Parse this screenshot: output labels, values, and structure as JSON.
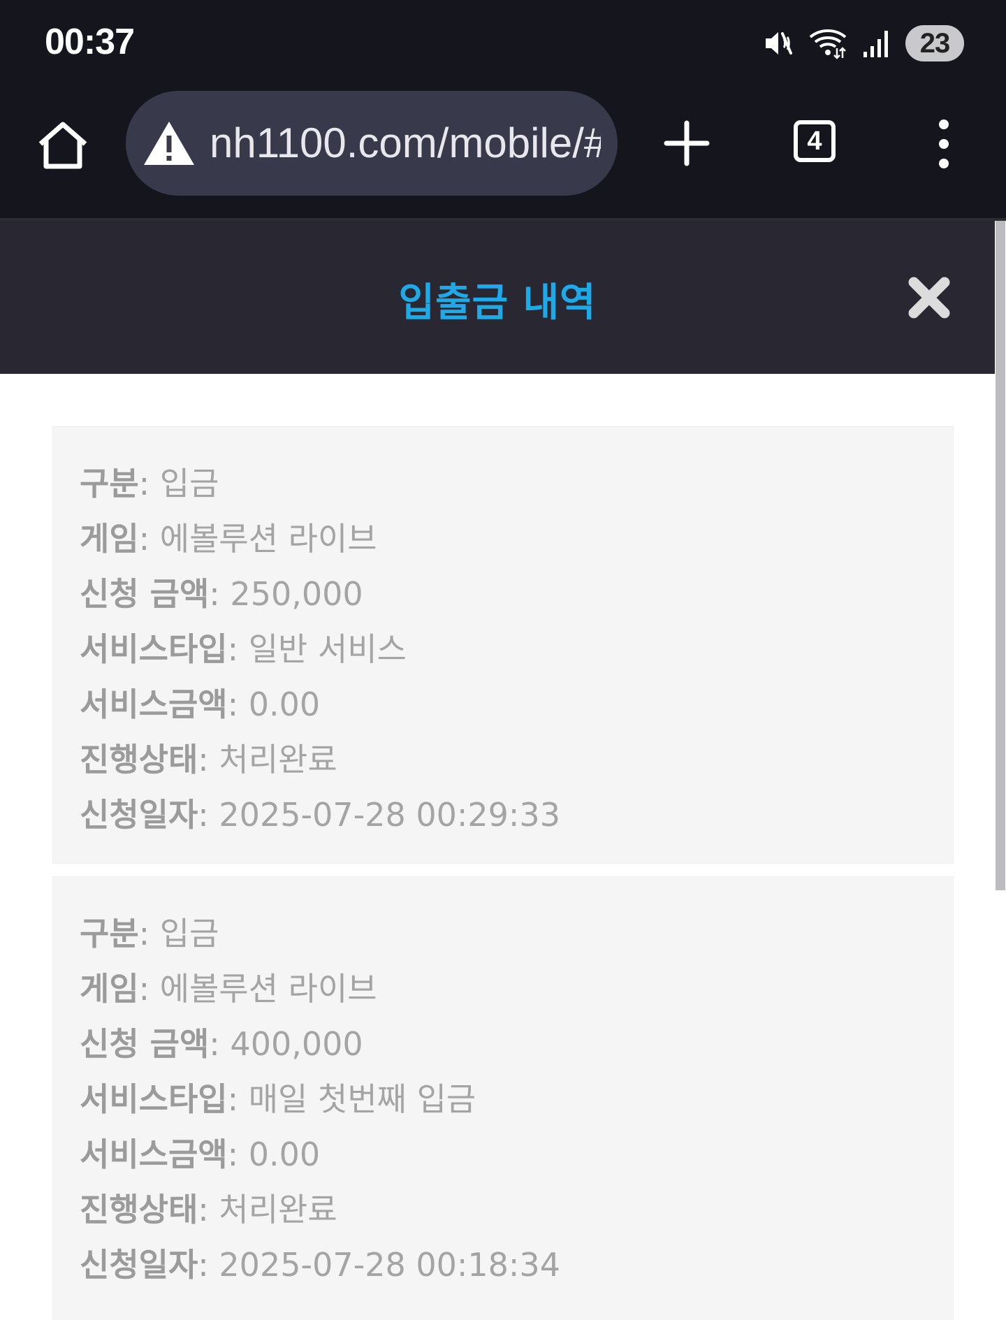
{
  "status_bar": {
    "time": "00:37",
    "battery": "23",
    "icons": [
      "mute-icon",
      "wifi-icon",
      "signal-icon"
    ]
  },
  "browser": {
    "url": "nh1100.com/mobile/#",
    "tab_count": "4",
    "icons": [
      "home-icon",
      "warning-icon",
      "plus-icon",
      "more-vert-icon"
    ]
  },
  "modal": {
    "title": "입출금 내역",
    "title_color": "#1ea9e8",
    "close_icon": "close-icon"
  },
  "records": [
    {
      "type_label": "구분",
      "type": "입금",
      "game_label": "게임",
      "game": "에볼루션 라이브",
      "amount_label": "신청 금액",
      "amount": "250,000",
      "service_type_label": "서비스타입",
      "service_type": "일반 서비스",
      "service_amount_label": "서비스금액",
      "service_amount": "0.00",
      "status_label": "진행상태",
      "status": "처리완료",
      "date_label": "신청일자",
      "date": "2025-07-28 00:29:33"
    },
    {
      "type_label": "구분",
      "type": "입금",
      "game_label": "게임",
      "game": "에볼루션 라이브",
      "amount_label": "신청 금액",
      "amount": "400,000",
      "service_type_label": "서비스타입",
      "service_type": "매일 첫번째 입금",
      "service_amount_label": "서비스금액",
      "service_amount": "0.00",
      "status_label": "진행상태",
      "status": "처리완료",
      "date_label": "신청일자",
      "date": "2025-07-28 00:18:34"
    }
  ]
}
